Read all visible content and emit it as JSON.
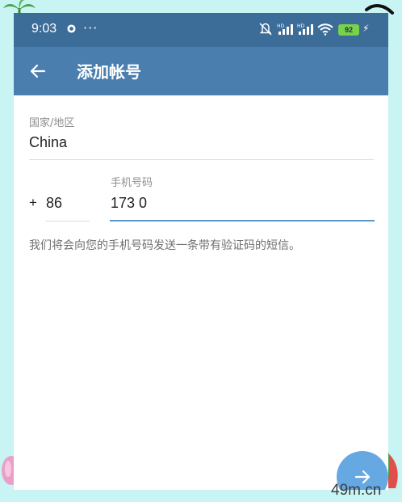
{
  "status_bar": {
    "time": "9:03",
    "more": "···",
    "battery": "92",
    "icons": [
      "dnd-icon",
      "mute-icon",
      "hd-signal-icon",
      "hd-signal-icon",
      "wifi-icon",
      "battery-icon",
      "charging-icon"
    ]
  },
  "app_bar": {
    "back_icon": "arrow-left-icon",
    "title": "添加帐号"
  },
  "form": {
    "country": {
      "label": "国家/地区",
      "value": "China"
    },
    "code_prefix": "+",
    "code_value": "86",
    "phone": {
      "label": "手机号码",
      "value": "173 0"
    },
    "hint": "我们将会向您的手机号码发送一条带有验证码的短信。"
  },
  "fab": {
    "icon": "arrow-right-icon"
  },
  "watermark": "49m.cn",
  "colors": {
    "status_bar": "#3c6c98",
    "app_bar": "#4a7eae",
    "accent": "#5b95c9",
    "fab": "#66a8e2",
    "background": "#c8f4f4"
  }
}
